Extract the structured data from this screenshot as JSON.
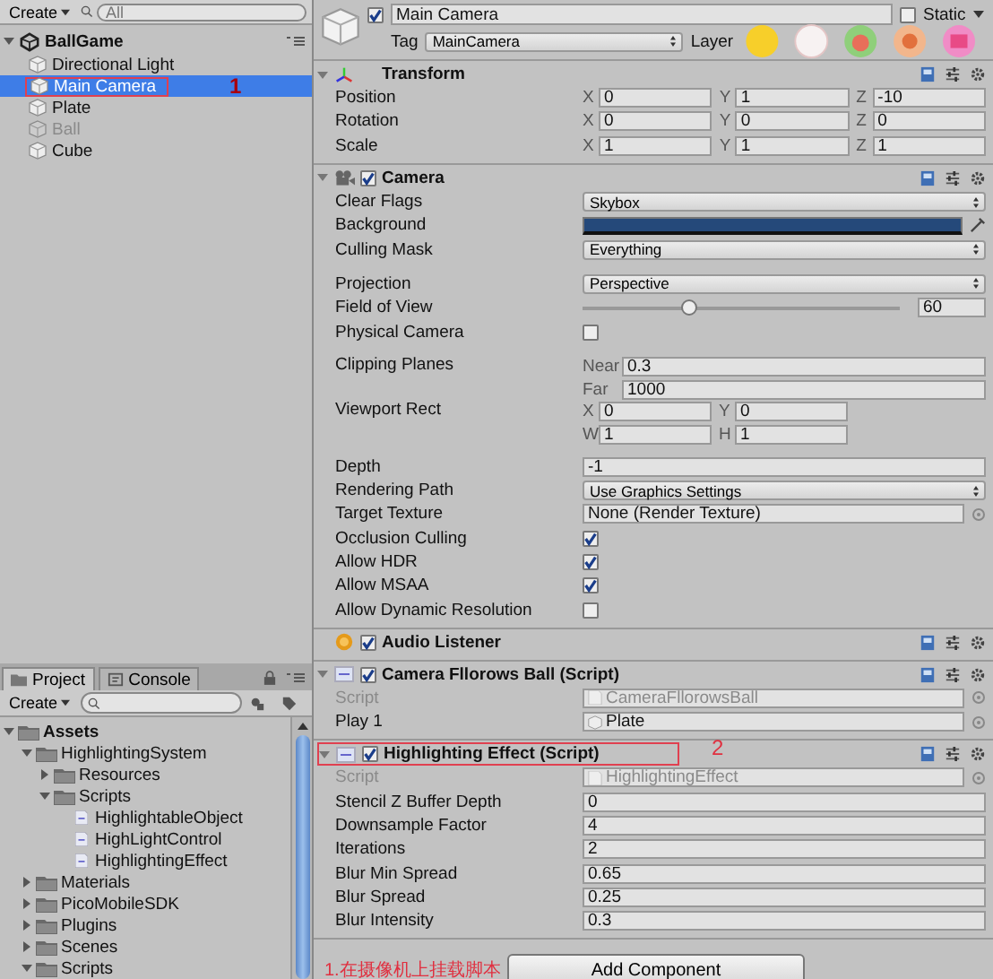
{
  "hierarchy": {
    "create_button": "Create",
    "search": {
      "placeholder": "All"
    },
    "scene": "BallGame",
    "items": [
      {
        "label": "Directional Light",
        "selected": false,
        "disabled": false,
        "circled": false
      },
      {
        "label": "Main Camera",
        "selected": true,
        "disabled": false,
        "circled": true,
        "note": "1"
      },
      {
        "label": "Plate",
        "selected": false,
        "disabled": false,
        "circled": false
      },
      {
        "label": "Ball",
        "selected": false,
        "disabled": true,
        "circled": false
      },
      {
        "label": "Cube",
        "selected": false,
        "disabled": false,
        "circled": false
      }
    ]
  },
  "project": {
    "tabs": [
      {
        "label": "Project",
        "selected": true
      },
      {
        "label": "Console",
        "selected": false
      }
    ],
    "create_button": "Create",
    "tree": [
      {
        "label": "Assets",
        "kind": "folder",
        "expanded": true,
        "children": [
          {
            "label": "HighlightingSystem",
            "kind": "folder",
            "expanded": true,
            "children": [
              {
                "label": "Resources",
                "kind": "folder",
                "expanded": false
              },
              {
                "label": "Scripts",
                "kind": "folder",
                "expanded": true,
                "children": [
                  {
                    "label": "HighlightableObject",
                    "kind": "script"
                  },
                  {
                    "label": "HighLightControl",
                    "kind": "script"
                  },
                  {
                    "label": "HighlightingEffect",
                    "kind": "script"
                  }
                ]
              }
            ]
          },
          {
            "label": "Materials",
            "kind": "folder",
            "expanded": false
          },
          {
            "label": "PicoMobileSDK",
            "kind": "folder",
            "expanded": false
          },
          {
            "label": "Plugins",
            "kind": "folder",
            "expanded": false
          },
          {
            "label": "Scenes",
            "kind": "folder",
            "expanded": false
          },
          {
            "label": "Scripts",
            "kind": "folder",
            "expanded": true
          }
        ]
      }
    ]
  },
  "inspector": {
    "object": {
      "active": true,
      "name": "Main Camera",
      "static_label": "Static",
      "static": false,
      "tag_label": "Tag",
      "tag": "MainCamera",
      "layer_label": "Layer"
    },
    "components": [
      {
        "title": "Transform",
        "kind": "transform",
        "foldout": true,
        "rows": [
          {
            "label": "Position",
            "kind": "vector",
            "fields": [
              {
                "axis": "X",
                "value": "0"
              },
              {
                "axis": "Y",
                "value": "1"
              },
              {
                "axis": "Z",
                "value": "-10"
              }
            ]
          },
          {
            "label": "Rotation",
            "kind": "vector",
            "fields": [
              {
                "axis": "X",
                "value": "0"
              },
              {
                "axis": "Y",
                "value": "0"
              },
              {
                "axis": "Z",
                "value": "0"
              }
            ]
          },
          {
            "label": "Scale",
            "kind": "vector",
            "fields": [
              {
                "axis": "X",
                "value": "1"
              },
              {
                "axis": "Y",
                "value": "1"
              },
              {
                "axis": "Z",
                "value": "1"
              }
            ]
          }
        ]
      },
      {
        "title": "Camera",
        "kind": "camera",
        "foldout": true,
        "enabled": true,
        "rows": [
          {
            "label": "Clear Flags",
            "kind": "dropdown",
            "value": "Skybox"
          },
          {
            "label": "Background",
            "kind": "color",
            "color": "#25497a"
          },
          {
            "label": "Culling Mask",
            "kind": "dropdown",
            "value": "Everything",
            "gap": true
          },
          {
            "label": "Projection",
            "kind": "dropdown",
            "value": "Perspective"
          },
          {
            "label": "Field of View",
            "kind": "slider",
            "level": 0.34,
            "value": "60"
          },
          {
            "label": "Physical Camera",
            "kind": "checkbox",
            "checked": false,
            "gap": true
          },
          {
            "label": "Clipping Planes",
            "kind": "stack",
            "fields": [
              {
                "axis": "Near",
                "value": "0.3"
              },
              {
                "axis": "Far",
                "value": "1000"
              }
            ]
          },
          {
            "label": "Viewport Rect",
            "kind": "grid",
            "fields": [
              {
                "axis": "X",
                "value": "0"
              },
              {
                "axis": "Y",
                "value": "0"
              },
              {
                "axis": "W",
                "value": "1"
              },
              {
                "axis": "H",
                "value": "1"
              }
            ],
            "gap": true
          },
          {
            "label": "Depth",
            "kind": "field",
            "value": "-1"
          },
          {
            "label": "Rendering Path",
            "kind": "dropdown",
            "value": "Use Graphics Settings"
          },
          {
            "label": "Target Texture",
            "kind": "object",
            "value": "None (Render Texture)"
          },
          {
            "label": "Occlusion Culling",
            "kind": "checkbox",
            "checked": true
          },
          {
            "label": "Allow HDR",
            "kind": "checkbox",
            "checked": true
          },
          {
            "label": "Allow MSAA",
            "kind": "checkbox",
            "checked": true
          },
          {
            "label": "Allow Dynamic Resolution",
            "kind": "checkbox",
            "checked": false
          }
        ]
      },
      {
        "title": "Audio Listener",
        "kind": "audio",
        "foldout": false,
        "enabled": true
      },
      {
        "title": "Camera Fllorows Ball (Script)",
        "kind": "script",
        "foldout": true,
        "enabled": true,
        "rows": [
          {
            "label": "Script",
            "kind": "script",
            "value": "CameraFllorowsBall"
          },
          {
            "label": "Play 1",
            "kind": "object",
            "value": "Plate",
            "icon": true
          }
        ]
      },
      {
        "title": "Highlighting Effect (Script)",
        "kind": "script",
        "foldout": true,
        "enabled": true,
        "circled": true,
        "note": "2",
        "rows": [
          {
            "label": "Script",
            "kind": "script",
            "value": "HighlightingEffect"
          },
          {
            "label": "Stencil Z Buffer Depth",
            "kind": "field",
            "value": "0"
          },
          {
            "label": "Downsample Factor",
            "kind": "field",
            "value": "4"
          },
          {
            "label": "Iterations",
            "kind": "field",
            "value": "2"
          },
          {
            "label": "Blur Min Spread",
            "kind": "field",
            "value": "0.65"
          },
          {
            "label": "Blur Spread",
            "kind": "field",
            "value": "0.25"
          },
          {
            "label": "Blur Intensity",
            "kind": "field",
            "value": "0.3"
          }
        ]
      }
    ],
    "add_component": "Add Component",
    "note": "1.在摄像机上挂载脚本"
  }
}
